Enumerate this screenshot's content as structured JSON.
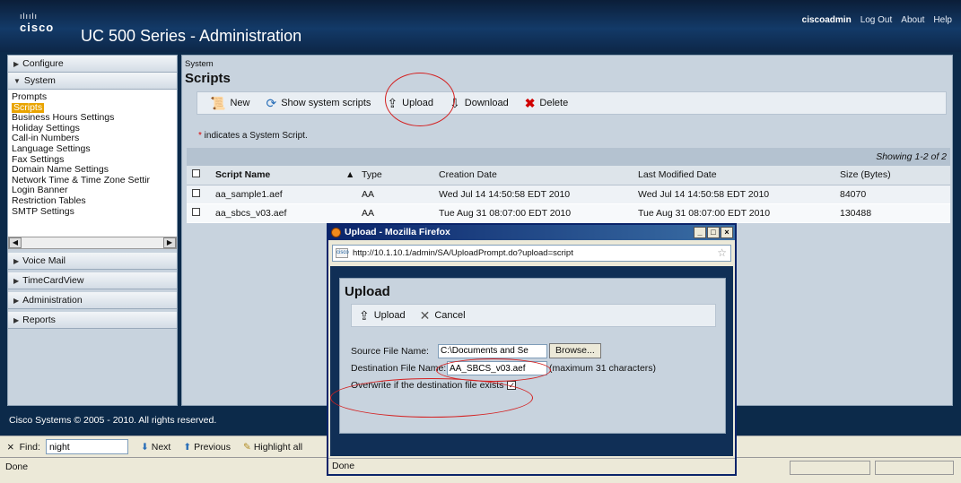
{
  "header": {
    "logo_text": "cisco",
    "logo_bars": "ılıılı",
    "title": "UC 500 Series - Administration",
    "user": "ciscoadmin",
    "links": [
      "Log Out",
      "About",
      "Help"
    ]
  },
  "sidebar": {
    "configure": "Configure",
    "system": "System",
    "system_items": [
      "Prompts",
      "Scripts",
      "Business Hours Settings",
      "Holiday Settings",
      "Call-in Numbers",
      "Language Settings",
      "Fax Settings",
      "Domain Name Settings",
      "Network Time & Time Zone Settir",
      "Login Banner",
      "Restriction Tables",
      "SMTP Settings"
    ],
    "selected_index": 1,
    "sections": [
      "Voice Mail",
      "TimeCardView",
      "Administration",
      "Reports"
    ]
  },
  "content": {
    "breadcrumb": "System",
    "title": "Scripts",
    "toolbar": {
      "new": "New",
      "show_system": "Show system scripts",
      "upload": "Upload",
      "download": "Download",
      "delete": "Delete"
    },
    "note_star": "*",
    "note": " indicates a System Script.",
    "showing": "Showing 1-2 of 2",
    "columns": [
      "Script Name",
      "Type",
      "Creation Date",
      "Last Modified Date",
      "Size (Bytes)"
    ],
    "sort_indicator": "▲",
    "rows": [
      {
        "name": "aa_sample1.aef",
        "type": "AA",
        "created": "Wed Jul 14 14:50:58 EDT 2010",
        "modified": "Wed Jul 14 14:50:58 EDT 2010",
        "size": "84070"
      },
      {
        "name": "aa_sbcs_v03.aef",
        "type": "AA",
        "created": "Tue Aug 31 08:07:00 EDT 2010",
        "modified": "Tue Aug 31 08:07:00 EDT 2010",
        "size": "130488"
      }
    ]
  },
  "footer": "Cisco Systems © 2005 - 2010. All rights reserved.",
  "findbar": {
    "close": "×",
    "label": "Find:",
    "value": "night",
    "next": "Next",
    "previous": "Previous",
    "highlight": "Highlight all"
  },
  "status": "Done",
  "popup": {
    "title": "Upload - Mozilla Firefox",
    "url": "http://10.1.10.1/admin/SA/UploadPrompt.do?upload=script",
    "heading": "Upload",
    "upload_btn": "Upload",
    "cancel_btn": "Cancel",
    "source_label": "Source File Name:",
    "source_value": "C:\\Documents and Se",
    "browse": "Browse...",
    "dest_label": "Destination File Name:",
    "dest_value": "AA_SBCS_v03.aef",
    "dest_hint": "(maximum 31 characters)",
    "overwrite_label": "Overwrite if the destination file exists",
    "overwrite_checked": true,
    "status": "Done"
  },
  "icons": {
    "new": "scroll-icon",
    "show_system": "refresh-icon",
    "upload": "upload-icon",
    "download": "download-icon",
    "delete": "delete-icon",
    "cancel": "cancel-icon"
  },
  "colors": {
    "header_bg": "#133a68",
    "selected_item": "#e9a400",
    "delete_red": "#d00000",
    "annotation_red": "#d42020"
  }
}
